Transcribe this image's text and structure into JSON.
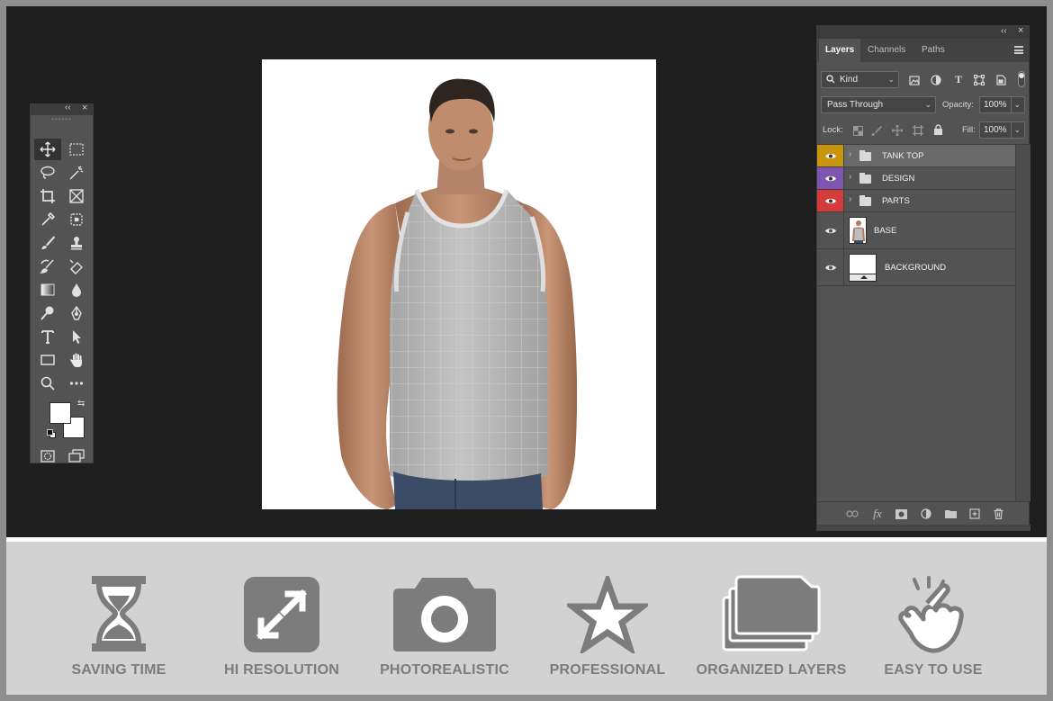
{
  "tools_panel": {
    "collapse_glyph": "‹‹",
    "close_glyph": "×",
    "tools": [
      {
        "name": "move-icon"
      },
      {
        "name": "marquee-icon"
      },
      {
        "name": "lasso-icon"
      },
      {
        "name": "magic-wand-icon"
      },
      {
        "name": "crop-icon"
      },
      {
        "name": "frame-icon"
      },
      {
        "name": "eyedropper-icon"
      },
      {
        "name": "spot-healing-icon"
      },
      {
        "name": "brush-icon"
      },
      {
        "name": "stamp-icon"
      },
      {
        "name": "history-brush-icon"
      },
      {
        "name": "eraser-icon"
      },
      {
        "name": "gradient-icon"
      },
      {
        "name": "blur-icon"
      },
      {
        "name": "dodge-icon"
      },
      {
        "name": "pen-icon"
      },
      {
        "name": "type-icon"
      },
      {
        "name": "path-select-icon"
      },
      {
        "name": "rectangle-icon"
      },
      {
        "name": "hand-icon"
      },
      {
        "name": "zoom-icon"
      },
      {
        "name": "more-tools-icon"
      }
    ]
  },
  "layers_panel": {
    "collapse_glyph": "‹‹",
    "close_glyph": "×",
    "tabs": [
      "Layers",
      "Channels",
      "Paths"
    ],
    "filter": {
      "value": "Kind"
    },
    "blend_mode": {
      "value": "Pass Through"
    },
    "opacity": {
      "label": "Opacity:",
      "value": "100%"
    },
    "lock": {
      "label": "Lock:"
    },
    "fill": {
      "label": "Fill:",
      "value": "100%"
    },
    "layers": [
      {
        "name": "TANK TOP",
        "type": "group",
        "color": "#c8950c",
        "selected": true
      },
      {
        "name": "DESIGN",
        "type": "group",
        "color": "#7e55b0",
        "selected": false
      },
      {
        "name": "PARTS",
        "type": "group",
        "color": "#d63b3b",
        "selected": false
      },
      {
        "name": "BASE",
        "type": "image",
        "color": "",
        "selected": false
      },
      {
        "name": "BACKGROUND",
        "type": "solid",
        "color": "",
        "selected": false
      }
    ],
    "fx_label": "fx"
  },
  "features": [
    {
      "label": "SAVING TIME",
      "icon": "hourglass-icon"
    },
    {
      "label": "HI RESOLUTION",
      "icon": "expand-icon"
    },
    {
      "label": "PHOTOREALISTIC",
      "icon": "camera-icon"
    },
    {
      "label": "PROFESSIONAL",
      "icon": "star-icon"
    },
    {
      "label": "ORGANIZED LAYERS",
      "icon": "layers-folder-icon"
    },
    {
      "label": "EASY TO USE",
      "icon": "pointing-hand-icon"
    }
  ],
  "colors": {
    "workspace": "#1e1e1e",
    "panel": "#535353",
    "feature_gray": "#7c7c7c",
    "tank_top_group": "#c8950c",
    "design_group": "#7e55b0",
    "parts_group": "#d63b3b"
  }
}
